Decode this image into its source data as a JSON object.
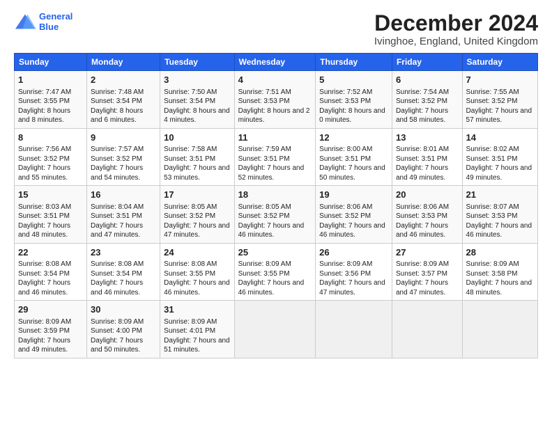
{
  "logo": {
    "line1": "General",
    "line2": "Blue"
  },
  "title": "December 2024",
  "location": "Ivinghoe, England, United Kingdom",
  "days_of_week": [
    "Sunday",
    "Monday",
    "Tuesday",
    "Wednesday",
    "Thursday",
    "Friday",
    "Saturday"
  ],
  "weeks": [
    [
      {
        "day": 1,
        "sunrise": "7:47 AM",
        "sunset": "3:55 PM",
        "daylight": "8 hours and 8 minutes."
      },
      {
        "day": 2,
        "sunrise": "7:48 AM",
        "sunset": "3:54 PM",
        "daylight": "8 hours and 6 minutes."
      },
      {
        "day": 3,
        "sunrise": "7:50 AM",
        "sunset": "3:54 PM",
        "daylight": "8 hours and 4 minutes."
      },
      {
        "day": 4,
        "sunrise": "7:51 AM",
        "sunset": "3:53 PM",
        "daylight": "8 hours and 2 minutes."
      },
      {
        "day": 5,
        "sunrise": "7:52 AM",
        "sunset": "3:53 PM",
        "daylight": "8 hours and 0 minutes."
      },
      {
        "day": 6,
        "sunrise": "7:54 AM",
        "sunset": "3:52 PM",
        "daylight": "7 hours and 58 minutes."
      },
      {
        "day": 7,
        "sunrise": "7:55 AM",
        "sunset": "3:52 PM",
        "daylight": "7 hours and 57 minutes."
      }
    ],
    [
      {
        "day": 8,
        "sunrise": "7:56 AM",
        "sunset": "3:52 PM",
        "daylight": "7 hours and 55 minutes."
      },
      {
        "day": 9,
        "sunrise": "7:57 AM",
        "sunset": "3:52 PM",
        "daylight": "7 hours and 54 minutes."
      },
      {
        "day": 10,
        "sunrise": "7:58 AM",
        "sunset": "3:51 PM",
        "daylight": "7 hours and 53 minutes."
      },
      {
        "day": 11,
        "sunrise": "7:59 AM",
        "sunset": "3:51 PM",
        "daylight": "7 hours and 52 minutes."
      },
      {
        "day": 12,
        "sunrise": "8:00 AM",
        "sunset": "3:51 PM",
        "daylight": "7 hours and 50 minutes."
      },
      {
        "day": 13,
        "sunrise": "8:01 AM",
        "sunset": "3:51 PM",
        "daylight": "7 hours and 49 minutes."
      },
      {
        "day": 14,
        "sunrise": "8:02 AM",
        "sunset": "3:51 PM",
        "daylight": "7 hours and 49 minutes."
      }
    ],
    [
      {
        "day": 15,
        "sunrise": "8:03 AM",
        "sunset": "3:51 PM",
        "daylight": "7 hours and 48 minutes."
      },
      {
        "day": 16,
        "sunrise": "8:04 AM",
        "sunset": "3:51 PM",
        "daylight": "7 hours and 47 minutes."
      },
      {
        "day": 17,
        "sunrise": "8:05 AM",
        "sunset": "3:52 PM",
        "daylight": "7 hours and 47 minutes."
      },
      {
        "day": 18,
        "sunrise": "8:05 AM",
        "sunset": "3:52 PM",
        "daylight": "7 hours and 46 minutes."
      },
      {
        "day": 19,
        "sunrise": "8:06 AM",
        "sunset": "3:52 PM",
        "daylight": "7 hours and 46 minutes."
      },
      {
        "day": 20,
        "sunrise": "8:06 AM",
        "sunset": "3:53 PM",
        "daylight": "7 hours and 46 minutes."
      },
      {
        "day": 21,
        "sunrise": "8:07 AM",
        "sunset": "3:53 PM",
        "daylight": "7 hours and 46 minutes."
      }
    ],
    [
      {
        "day": 22,
        "sunrise": "8:08 AM",
        "sunset": "3:54 PM",
        "daylight": "7 hours and 46 minutes."
      },
      {
        "day": 23,
        "sunrise": "8:08 AM",
        "sunset": "3:54 PM",
        "daylight": "7 hours and 46 minutes."
      },
      {
        "day": 24,
        "sunrise": "8:08 AM",
        "sunset": "3:55 PM",
        "daylight": "7 hours and 46 minutes."
      },
      {
        "day": 25,
        "sunrise": "8:09 AM",
        "sunset": "3:55 PM",
        "daylight": "7 hours and 46 minutes."
      },
      {
        "day": 26,
        "sunrise": "8:09 AM",
        "sunset": "3:56 PM",
        "daylight": "7 hours and 47 minutes."
      },
      {
        "day": 27,
        "sunrise": "8:09 AM",
        "sunset": "3:57 PM",
        "daylight": "7 hours and 47 minutes."
      },
      {
        "day": 28,
        "sunrise": "8:09 AM",
        "sunset": "3:58 PM",
        "daylight": "7 hours and 48 minutes."
      }
    ],
    [
      {
        "day": 29,
        "sunrise": "8:09 AM",
        "sunset": "3:59 PM",
        "daylight": "7 hours and 49 minutes."
      },
      {
        "day": 30,
        "sunrise": "8:09 AM",
        "sunset": "4:00 PM",
        "daylight": "7 hours and 50 minutes."
      },
      {
        "day": 31,
        "sunrise": "8:09 AM",
        "sunset": "4:01 PM",
        "daylight": "7 hours and 51 minutes."
      },
      null,
      null,
      null,
      null
    ]
  ]
}
